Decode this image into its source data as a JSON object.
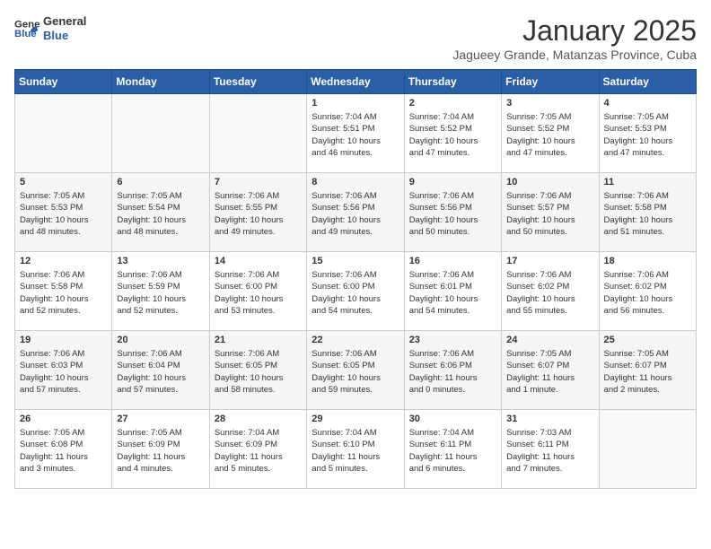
{
  "logo": {
    "general": "General",
    "blue": "Blue"
  },
  "title": "January 2025",
  "subtitle": "Jagueey Grande, Matanzas Province, Cuba",
  "weekdays": [
    "Sunday",
    "Monday",
    "Tuesday",
    "Wednesday",
    "Thursday",
    "Friday",
    "Saturday"
  ],
  "weeks": [
    [
      {
        "day": "",
        "content": ""
      },
      {
        "day": "",
        "content": ""
      },
      {
        "day": "",
        "content": ""
      },
      {
        "day": "1",
        "content": "Sunrise: 7:04 AM\nSunset: 5:51 PM\nDaylight: 10 hours\nand 46 minutes."
      },
      {
        "day": "2",
        "content": "Sunrise: 7:04 AM\nSunset: 5:52 PM\nDaylight: 10 hours\nand 47 minutes."
      },
      {
        "day": "3",
        "content": "Sunrise: 7:05 AM\nSunset: 5:52 PM\nDaylight: 10 hours\nand 47 minutes."
      },
      {
        "day": "4",
        "content": "Sunrise: 7:05 AM\nSunset: 5:53 PM\nDaylight: 10 hours\nand 47 minutes."
      }
    ],
    [
      {
        "day": "5",
        "content": "Sunrise: 7:05 AM\nSunset: 5:53 PM\nDaylight: 10 hours\nand 48 minutes."
      },
      {
        "day": "6",
        "content": "Sunrise: 7:05 AM\nSunset: 5:54 PM\nDaylight: 10 hours\nand 48 minutes."
      },
      {
        "day": "7",
        "content": "Sunrise: 7:06 AM\nSunset: 5:55 PM\nDaylight: 10 hours\nand 49 minutes."
      },
      {
        "day": "8",
        "content": "Sunrise: 7:06 AM\nSunset: 5:56 PM\nDaylight: 10 hours\nand 49 minutes."
      },
      {
        "day": "9",
        "content": "Sunrise: 7:06 AM\nSunset: 5:56 PM\nDaylight: 10 hours\nand 50 minutes."
      },
      {
        "day": "10",
        "content": "Sunrise: 7:06 AM\nSunset: 5:57 PM\nDaylight: 10 hours\nand 50 minutes."
      },
      {
        "day": "11",
        "content": "Sunrise: 7:06 AM\nSunset: 5:58 PM\nDaylight: 10 hours\nand 51 minutes."
      }
    ],
    [
      {
        "day": "12",
        "content": "Sunrise: 7:06 AM\nSunset: 5:58 PM\nDaylight: 10 hours\nand 52 minutes."
      },
      {
        "day": "13",
        "content": "Sunrise: 7:06 AM\nSunset: 5:59 PM\nDaylight: 10 hours\nand 52 minutes."
      },
      {
        "day": "14",
        "content": "Sunrise: 7:06 AM\nSunset: 6:00 PM\nDaylight: 10 hours\nand 53 minutes."
      },
      {
        "day": "15",
        "content": "Sunrise: 7:06 AM\nSunset: 6:00 PM\nDaylight: 10 hours\nand 54 minutes."
      },
      {
        "day": "16",
        "content": "Sunrise: 7:06 AM\nSunset: 6:01 PM\nDaylight: 10 hours\nand 54 minutes."
      },
      {
        "day": "17",
        "content": "Sunrise: 7:06 AM\nSunset: 6:02 PM\nDaylight: 10 hours\nand 55 minutes."
      },
      {
        "day": "18",
        "content": "Sunrise: 7:06 AM\nSunset: 6:02 PM\nDaylight: 10 hours\nand 56 minutes."
      }
    ],
    [
      {
        "day": "19",
        "content": "Sunrise: 7:06 AM\nSunset: 6:03 PM\nDaylight: 10 hours\nand 57 minutes."
      },
      {
        "day": "20",
        "content": "Sunrise: 7:06 AM\nSunset: 6:04 PM\nDaylight: 10 hours\nand 57 minutes."
      },
      {
        "day": "21",
        "content": "Sunrise: 7:06 AM\nSunset: 6:05 PM\nDaylight: 10 hours\nand 58 minutes."
      },
      {
        "day": "22",
        "content": "Sunrise: 7:06 AM\nSunset: 6:05 PM\nDaylight: 10 hours\nand 59 minutes."
      },
      {
        "day": "23",
        "content": "Sunrise: 7:06 AM\nSunset: 6:06 PM\nDaylight: 11 hours\nand 0 minutes."
      },
      {
        "day": "24",
        "content": "Sunrise: 7:05 AM\nSunset: 6:07 PM\nDaylight: 11 hours\nand 1 minute."
      },
      {
        "day": "25",
        "content": "Sunrise: 7:05 AM\nSunset: 6:07 PM\nDaylight: 11 hours\nand 2 minutes."
      }
    ],
    [
      {
        "day": "26",
        "content": "Sunrise: 7:05 AM\nSunset: 6:08 PM\nDaylight: 11 hours\nand 3 minutes."
      },
      {
        "day": "27",
        "content": "Sunrise: 7:05 AM\nSunset: 6:09 PM\nDaylight: 11 hours\nand 4 minutes."
      },
      {
        "day": "28",
        "content": "Sunrise: 7:04 AM\nSunset: 6:09 PM\nDaylight: 11 hours\nand 5 minutes."
      },
      {
        "day": "29",
        "content": "Sunrise: 7:04 AM\nSunset: 6:10 PM\nDaylight: 11 hours\nand 5 minutes."
      },
      {
        "day": "30",
        "content": "Sunrise: 7:04 AM\nSunset: 6:11 PM\nDaylight: 11 hours\nand 6 minutes."
      },
      {
        "day": "31",
        "content": "Sunrise: 7:03 AM\nSunset: 6:11 PM\nDaylight: 11 hours\nand 7 minutes."
      },
      {
        "day": "",
        "content": ""
      }
    ]
  ]
}
